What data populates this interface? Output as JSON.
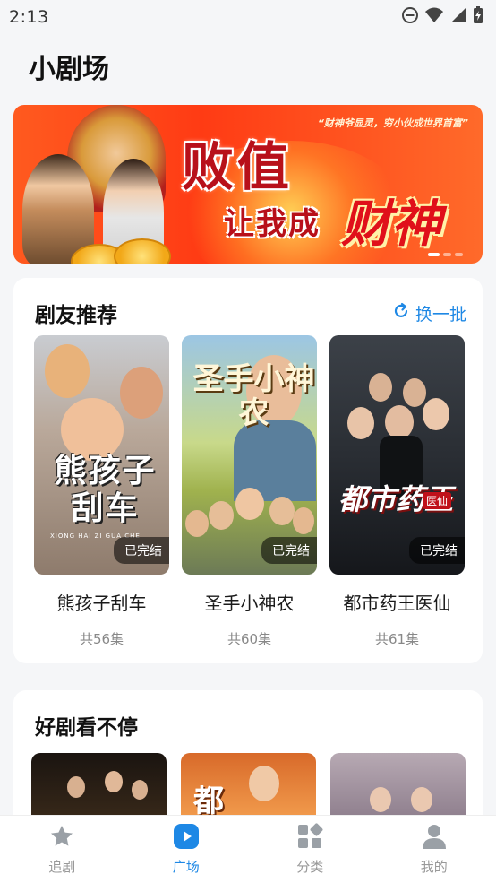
{
  "status_bar": {
    "time": "2:13",
    "icons": [
      "dnd-icon",
      "wifi-icon",
      "signal-icon",
      "battery-charging-icon"
    ]
  },
  "page": {
    "title": "小剧场"
  },
  "banner": {
    "quote": "“财神爷显灵，穷小伙成世界首富”",
    "line1": "败值",
    "line2": "让我成",
    "line3": "财神",
    "dots": 3,
    "active_dot": 0
  },
  "recommend": {
    "title": "剧友推荐",
    "refresh_label": "换一批",
    "refresh_icon": "refresh-icon",
    "items": [
      {
        "name": "熊孩子刮车",
        "poster_title": "熊孩子刮车",
        "poster_sub": "XIONG HAI ZI GUA CHE",
        "badge": "已完结",
        "episodes": "共56集"
      },
      {
        "name": "圣手小神农",
        "poster_title": "圣手小神农",
        "poster_sub": "",
        "badge": "已完结",
        "episodes": "共60集"
      },
      {
        "name": "都市药王医仙",
        "poster_title": "都市药王",
        "poster_sub": "医仙",
        "badge": "已完结",
        "episodes": "共61集"
      }
    ]
  },
  "nonstop": {
    "title": "好剧看不停",
    "poster_3_text": "都"
  },
  "bottom_nav": {
    "items": [
      {
        "label": "追剧",
        "icon": "star-icon",
        "active": false
      },
      {
        "label": "广场",
        "icon": "play-icon",
        "active": true
      },
      {
        "label": "分类",
        "icon": "category-icon",
        "active": false
      },
      {
        "label": "我的",
        "icon": "profile-icon",
        "active": false
      }
    ],
    "active_color": "#1e88e5",
    "inactive_color": "#999999"
  }
}
